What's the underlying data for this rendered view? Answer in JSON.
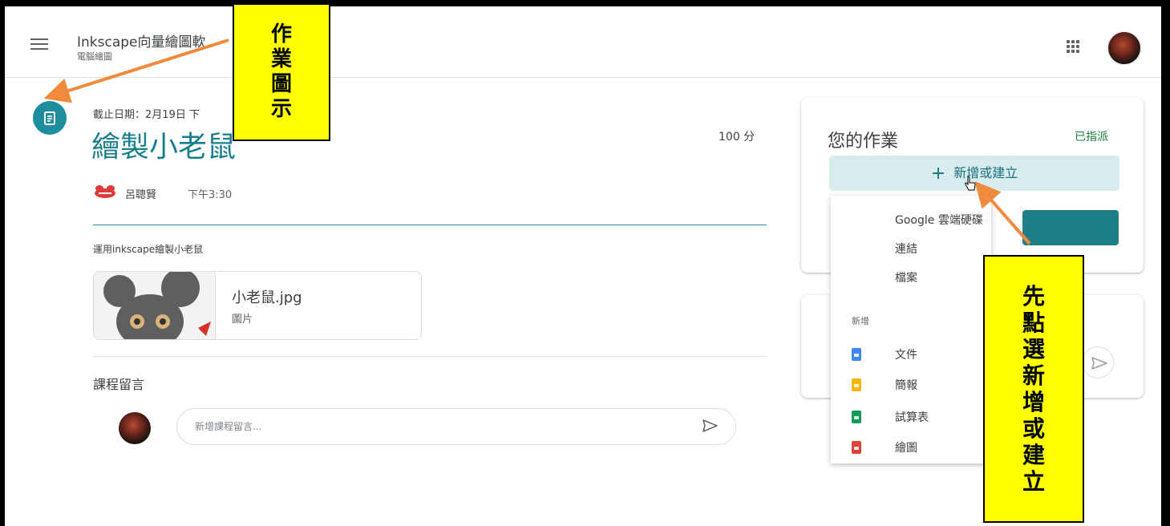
{
  "header": {
    "class_title": "Inkscape向量繪圖軟",
    "class_subtitle": "電腦繪圖"
  },
  "assignment": {
    "due_date": "截止日期：2月19日 下",
    "title": "繪製小老鼠",
    "points": "100 分",
    "author": "呂聰賢",
    "posted_time": "下午3:30",
    "description": "運用inkscape繪製小老鼠",
    "attachment": {
      "name": "小老鼠.jpg",
      "type": "圖片"
    },
    "comments_label": "課程留言",
    "comment_placeholder": "新增課程留言..."
  },
  "your_work": {
    "title": "您的作業",
    "status": "已指派",
    "add_create_label": "新增或建立",
    "add_menu": {
      "items": [
        "Google 雲端硬碟",
        "連結",
        "檔案"
      ],
      "new_section_label": "新增",
      "new_items": [
        {
          "label": "文件",
          "color": "#4285f4",
          "icon": "docs-icon"
        },
        {
          "label": "簡報",
          "color": "#f4b400",
          "icon": "slides-icon"
        },
        {
          "label": "試算表",
          "color": "#0f9d58",
          "icon": "sheets-icon"
        },
        {
          "label": "繪圖",
          "color": "#db4437",
          "icon": "drawings-icon"
        }
      ]
    }
  },
  "annotations": {
    "icon_note": [
      "作",
      "業",
      "圖",
      "示"
    ],
    "add_note": [
      "先",
      "點",
      "選",
      "新",
      "增",
      "或",
      "建",
      "立"
    ],
    "box_color": "#ffff00",
    "arrow_color": "#f08a3c"
  },
  "colors": {
    "accent": "#1e8e9e",
    "title": "#1a7f8c",
    "status_green": "#188038"
  }
}
